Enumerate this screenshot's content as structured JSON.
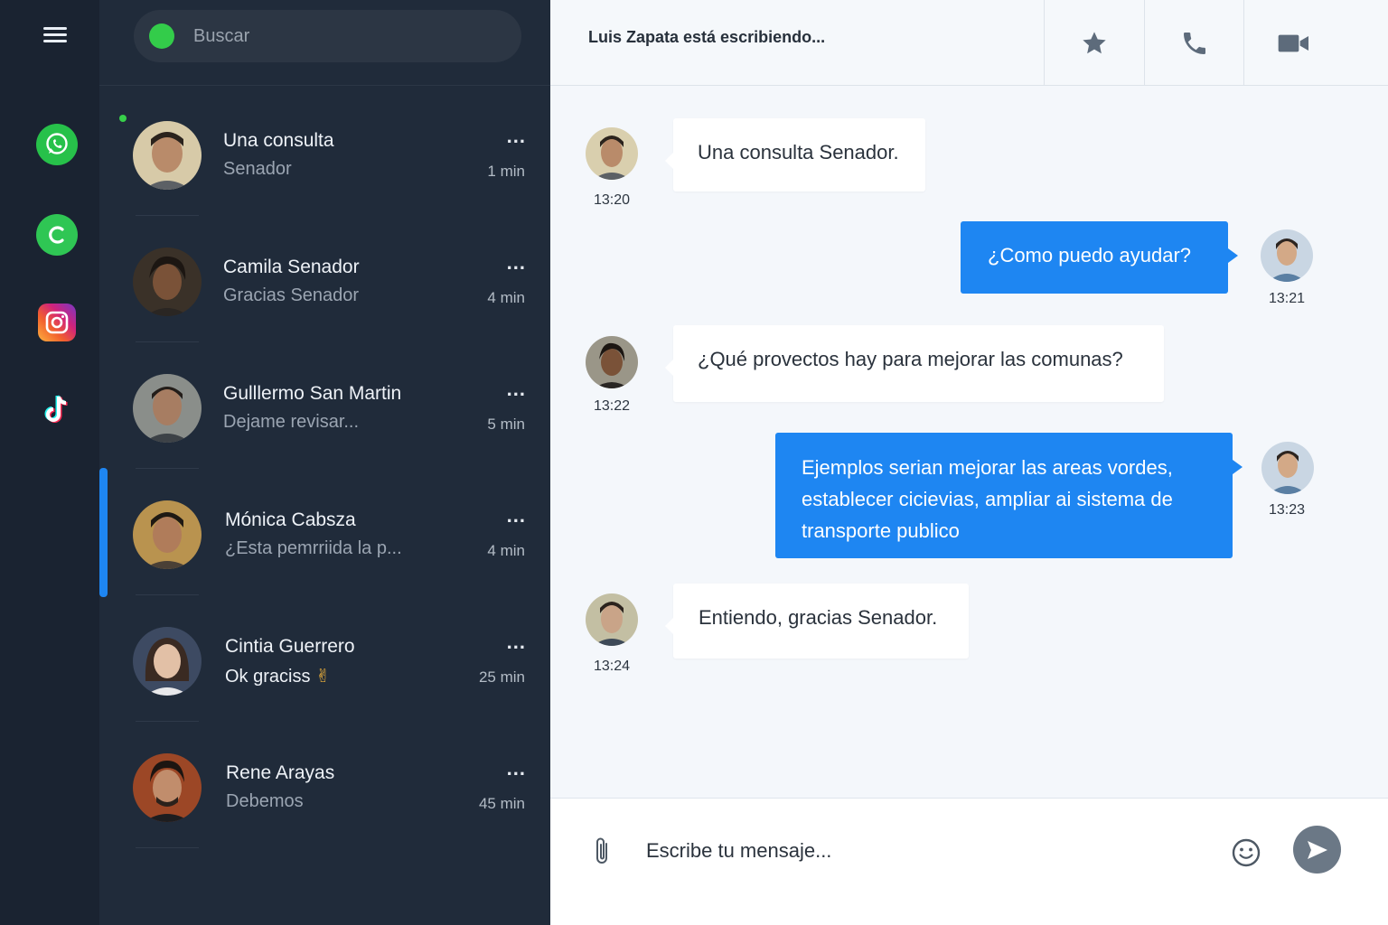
{
  "search": {
    "placeholder": "Buscar"
  },
  "conversations": [
    {
      "name": "Una consulta",
      "preview": "Senador",
      "time": "1 min",
      "more": "...",
      "avatar_color": "#c9b58f"
    },
    {
      "name": "Camila Senador",
      "preview": "Gracias Senador",
      "time": "4 min",
      "more": "...",
      "avatar_color": "#6a4a36"
    },
    {
      "name": "Gulllermo San Martin",
      "preview": "Dejame revisar...",
      "time": "5 min",
      "more": "...",
      "avatar_color": "#7d7e7a"
    },
    {
      "name": "Mónica Cabsza",
      "preview": "¿Esta pemrriida la p...",
      "time": "4 min",
      "more": "...",
      "avatar_color": "#b08a58"
    },
    {
      "name": "Cintia Guerrero",
      "preview": "Ok graciss",
      "preview_emoji": "✌",
      "time": "25 min",
      "more": "...",
      "avatar_color": "#3c4a63"
    },
    {
      "name": "Rene Arayas",
      "preview": "Debemos",
      "time": "45 min",
      "more": "...",
      "avatar_color": "#a24a2a"
    }
  ],
  "header": {
    "status": "Luis Zapata está escribiendo..."
  },
  "messages": [
    {
      "direction": "in",
      "text": "Una consulta Senador.",
      "time": "13:20"
    },
    {
      "direction": "out",
      "text": "¿Como puedo ayudar?",
      "time": "13:21"
    },
    {
      "direction": "in",
      "text": "¿Qué provectos hay para mejorar las comunas?",
      "time": "13:22"
    },
    {
      "direction": "out",
      "lines": [
        "Ejemplos serian mejorar las areas vordes,",
        "establecer cicievias, ampliar ai sistema de",
        "transporte publico"
      ],
      "time": "13:23"
    },
    {
      "direction": "in",
      "text": "Entiendo, gracias Senador.",
      "time": "13:24"
    }
  ],
  "composer": {
    "placeholder": "Escribe tu mensaje..."
  },
  "colors": {
    "accent": "#1e86f2",
    "sidebar": "#202b3a",
    "rail": "#1a2331",
    "online": "#37d04a"
  }
}
